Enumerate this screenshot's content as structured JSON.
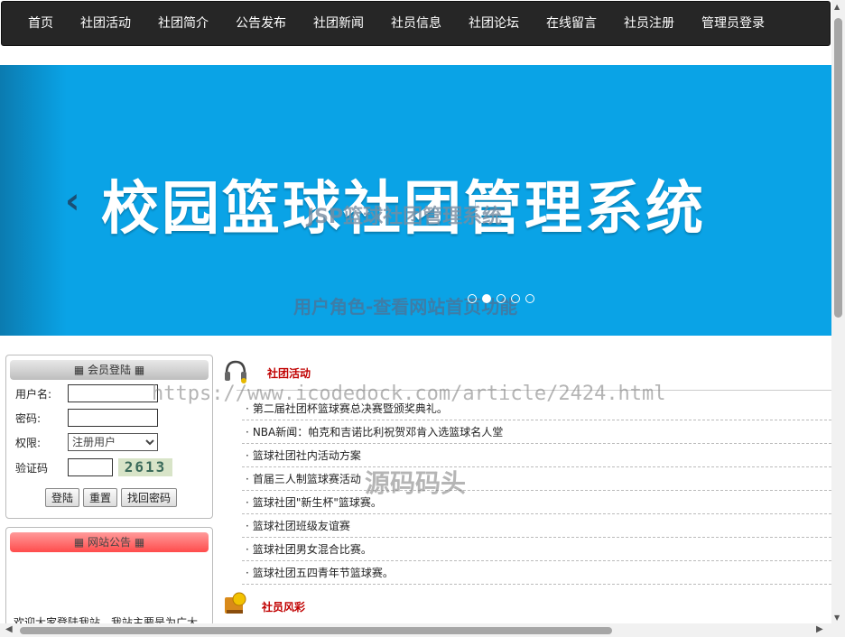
{
  "nav": {
    "items": [
      "首页",
      "社团活动",
      "社团简介",
      "公告发布",
      "社团新闻",
      "社员信息",
      "社团论坛",
      "在线留言",
      "社员注册",
      "管理员登录"
    ]
  },
  "banner": {
    "title": "校园篮球社团管理系统",
    "overlay_subtitle": "JSP篮球社团管理系统",
    "caption": "用户角色-查看网站首页功能",
    "prev_icon": "chevron-left-icon",
    "dots_count": 5,
    "active_dot": 2
  },
  "login": {
    "header": "会员登陆",
    "username_label": "用户名:",
    "password_label": "密码:",
    "role_label": "权限:",
    "role_selected": "注册用户",
    "captcha_label": "验证码",
    "captcha_value": "2613",
    "buttons": {
      "login": "登陆",
      "reset": "重置",
      "forgot": "找回密码"
    }
  },
  "notice": {
    "header": "网站公告",
    "text": "欢迎大家登陆我站，我站主要是为广大"
  },
  "activities": {
    "title": "社团活动",
    "icon": "headphones-icon",
    "items": [
      "第二届社团杯篮球赛总决赛暨颁奖典礼。",
      "NBA新闻：帕克和吉诺比利祝贺邓肯入选篮球名人堂",
      "篮球社团社内活动方案",
      "首届三人制篮球赛活动",
      "篮球社团\"新生杯\"篮球赛。",
      "篮球社团班级友谊赛",
      "篮球社团男女混合比赛。",
      "篮球社团五四青年节篮球赛。"
    ]
  },
  "members": {
    "title": "社员风彩",
    "icon": "trophy-book-icon"
  },
  "watermark": {
    "url": "https://www.icodedock.com/article/2424.html",
    "text": "源码码头"
  }
}
